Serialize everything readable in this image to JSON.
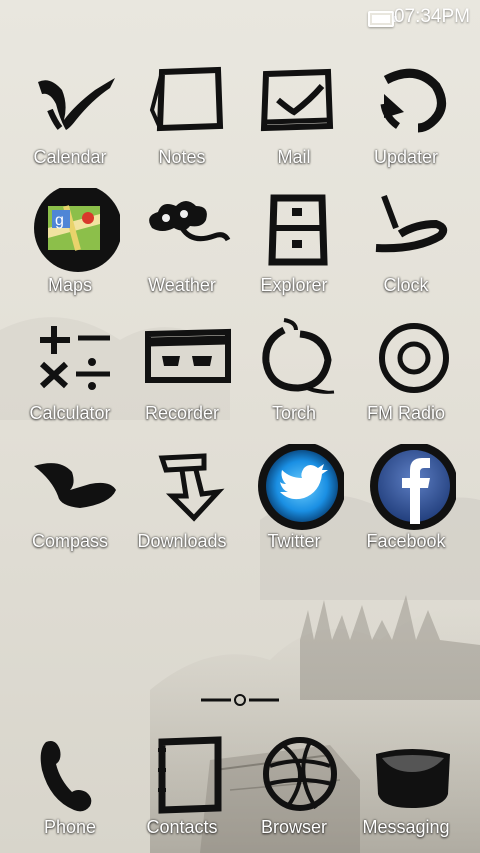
{
  "status_bar": {
    "time": "07:34PM",
    "battery_icon": "battery-full-icon"
  },
  "apps": [
    {
      "label": "Calendar",
      "icon": "calendar-icon"
    },
    {
      "label": "Notes",
      "icon": "notes-icon"
    },
    {
      "label": "Mail",
      "icon": "mail-icon"
    },
    {
      "label": "Updater",
      "icon": "updater-icon"
    },
    {
      "label": "Maps",
      "icon": "maps-icon"
    },
    {
      "label": "Weather",
      "icon": "weather-icon"
    },
    {
      "label": "Explorer",
      "icon": "explorer-icon"
    },
    {
      "label": "Clock",
      "icon": "clock-icon"
    },
    {
      "label": "Calculator",
      "icon": "calculator-icon"
    },
    {
      "label": "Recorder",
      "icon": "recorder-icon"
    },
    {
      "label": "Torch",
      "icon": "torch-icon"
    },
    {
      "label": "FM Radio",
      "icon": "radio-icon"
    },
    {
      "label": "Compass",
      "icon": "compass-icon"
    },
    {
      "label": "Downloads",
      "icon": "downloads-icon"
    },
    {
      "label": "Twitter",
      "icon": "twitter-icon"
    },
    {
      "label": "Facebook",
      "icon": "facebook-icon"
    }
  ],
  "dock": [
    {
      "label": "Phone",
      "icon": "phone-icon"
    },
    {
      "label": "Contacts",
      "icon": "contacts-icon"
    },
    {
      "label": "Browser",
      "icon": "globe-icon"
    },
    {
      "label": "Messaging",
      "icon": "message-icon"
    }
  ],
  "colors": {
    "ink": "#111111",
    "twitter": "#1da1f2",
    "facebook": "#3b5998",
    "label": "#ffffff"
  }
}
